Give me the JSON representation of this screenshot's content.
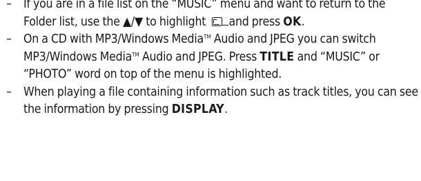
{
  "bullets": [
    {
      "dash": "–",
      "text_before": "If you are in a file list on the “MUSIC” menu and want to return to the Folder list, use the ",
      "arrows": "▲/▼",
      "text_middle": " to highlight ",
      "icon": "folder-up-icon",
      "text_after": "and press ",
      "key": "OK",
      "end": "."
    },
    {
      "dash": "–",
      "seg1": "On a CD with MP3/Windows Media",
      "tm1": "TM",
      "seg2": " Audio and JPEG you can switch MP3/Windows Media",
      "tm2": "TM",
      "seg3": " Audio and JPEG. Press ",
      "key": "TITLE",
      "seg4": " and “MUSIC” or “PHOTO” word on top of the menu is highlighted."
    },
    {
      "dash": "–",
      "text_before": "When playing a file containing information such as track titles, you can see the information by pressing ",
      "key": "DISPLAY",
      "end": "."
    }
  ]
}
